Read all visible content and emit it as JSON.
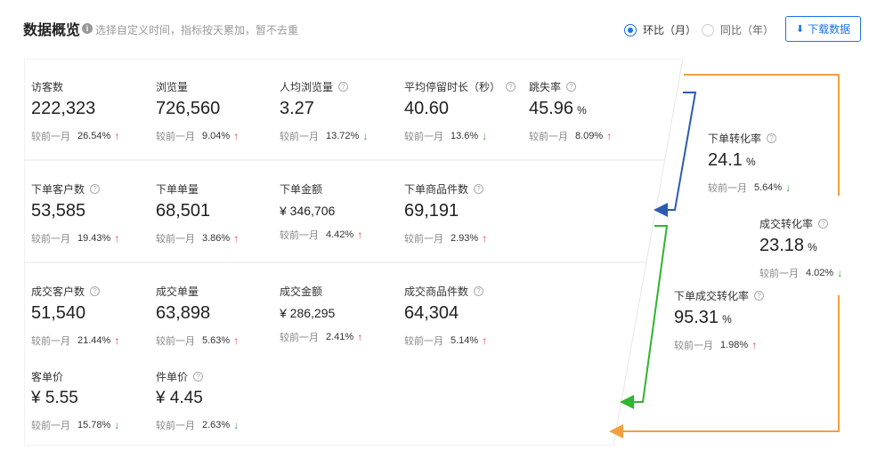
{
  "header": {
    "title": "数据概览",
    "hint": "选择自定义时间，指标按天累加，暂不去重",
    "radio_mom": "环比（月）",
    "radio_yoy": "同比（年）",
    "download": "下载数据"
  },
  "compare_label": "较前一月",
  "metrics": [
    {
      "label": "访客数",
      "value": "222,323",
      "pct": "26.54%",
      "dir": "up",
      "help": false
    },
    {
      "label": "浏览量",
      "value": "726,560",
      "pct": "9.04%",
      "dir": "up",
      "help": false
    },
    {
      "label": "人均浏览量",
      "value": "3.27",
      "pct": "13.72%",
      "dir": "down",
      "help": true
    },
    {
      "label": "平均停留时长（秒）",
      "value": "40.60",
      "pct": "13.6%",
      "dir": "down",
      "help": true
    },
    {
      "label": "跳失率",
      "value": "45.96",
      "unit": "%",
      "pct": "8.09%",
      "dir": "up",
      "help": true
    },
    {
      "label": "下单客户数",
      "value": "53,585",
      "pct": "19.43%",
      "dir": "up",
      "help": true
    },
    {
      "label": "下单单量",
      "value": "68,501",
      "pct": "3.86%",
      "dir": "up",
      "help": false
    },
    {
      "label": "下单金额",
      "value": "¥ 346,706",
      "pct": "4.42%",
      "dir": "up",
      "help": false
    },
    {
      "label": "下单商品件数",
      "value": "69,191",
      "pct": "2.93%",
      "dir": "up",
      "help": true
    },
    {
      "label": "成交客户数",
      "value": "51,540",
      "pct": "21.44%",
      "dir": "up",
      "help": true
    },
    {
      "label": "成交单量",
      "value": "63,898",
      "pct": "5.63%",
      "dir": "up",
      "help": false
    },
    {
      "label": "成交金额",
      "value": "¥ 286,295",
      "pct": "2.41%",
      "dir": "up",
      "help": false
    },
    {
      "label": "成交商品件数",
      "value": "64,304",
      "pct": "5.14%",
      "dir": "up",
      "help": true
    },
    {
      "label": "客单价",
      "value": "¥ 5.55",
      "pct": "15.78%",
      "dir": "down",
      "help": false
    },
    {
      "label": "件单价",
      "value": "¥ 4.45",
      "pct": "2.63%",
      "dir": "down",
      "help": true
    }
  ],
  "rates": [
    {
      "label": "下单转化率",
      "value": "24.1",
      "unit": "%",
      "pct": "5.64%",
      "dir": "down",
      "help": true
    },
    {
      "label": "成交转化率",
      "value": "23.18",
      "unit": "%",
      "pct": "4.02%",
      "dir": "down",
      "help": true
    },
    {
      "label": "下单成交转化率",
      "value": "95.31",
      "unit": "%",
      "pct": "1.98%",
      "dir": "up",
      "help": true
    }
  ],
  "colors": {
    "accent": "#1a73e8",
    "up": "#e53935",
    "down": "#2e9d3a",
    "arrow_blue": "#2a5db0",
    "arrow_green": "#2fb52f",
    "arrow_orange": "#f0a040"
  }
}
